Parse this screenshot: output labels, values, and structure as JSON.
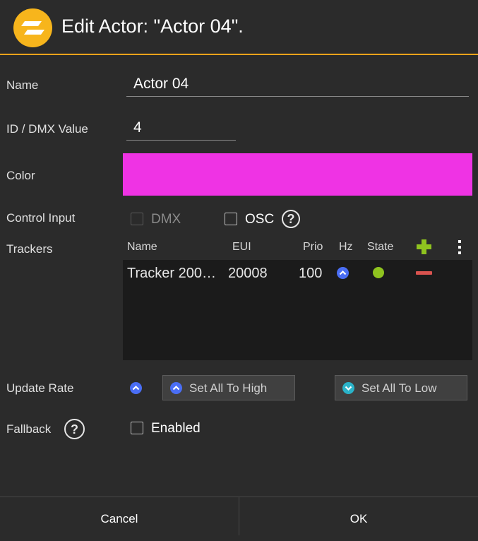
{
  "dialog": {
    "title": "Edit Actor: \"Actor 04\".",
    "logo_icon": "zone-logo-icon"
  },
  "fields": {
    "name_label": "Name",
    "name_value": "Actor 04",
    "id_label": "ID / DMX Value",
    "id_value": "4",
    "color_label": "Color",
    "color_value": "#ef33e4",
    "control_input_label": "Control Input",
    "dmx_label": "DMX",
    "osc_label": "OSC",
    "trackers_label": "Trackers",
    "update_rate_label": "Update Rate",
    "fallback_label": "Fallback",
    "enabled_label": "Enabled"
  },
  "trackers": {
    "columns": [
      "Name",
      "EUI",
      "Prio",
      "Hz",
      "State"
    ],
    "rows": [
      {
        "name": "Tracker 200…",
        "eui": "20008",
        "prio": "100",
        "hz": "high",
        "state": "ok"
      }
    ]
  },
  "buttons": {
    "set_all_high": "Set All To High",
    "set_all_low": "Set All To Low",
    "cancel": "Cancel",
    "ok": "OK"
  },
  "colors": {
    "accent": "#f5a31a",
    "hz_high": "#4a6ef5",
    "hz_low": "#2ab3c9",
    "state_ok": "#8fc31f",
    "remove": "#d9534f",
    "add": "#8fc31f"
  }
}
